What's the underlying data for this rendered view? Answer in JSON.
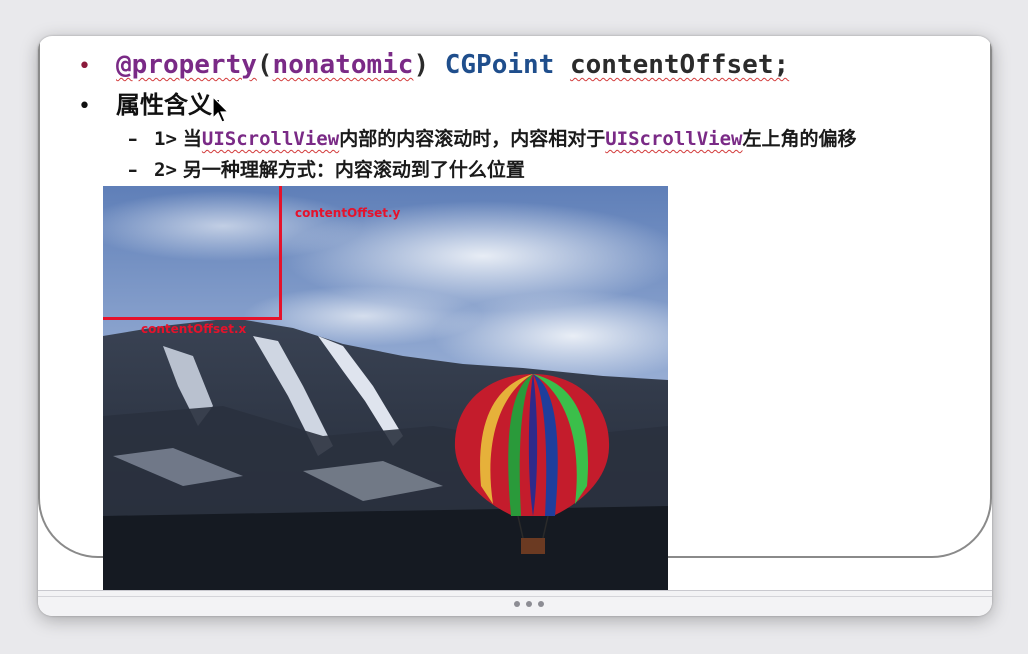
{
  "slide": {
    "line1": {
      "at_property": "@property",
      "open_paren": "(",
      "nonatomic": "nonatomic",
      "close_paren": ")",
      "type": "CGPoint",
      "name": "contentOffset;"
    },
    "heading": "属性含义:",
    "sub_items": [
      {
        "dash": "–",
        "num": "1>",
        "part1": "当",
        "code1": "UIScrollView",
        "part2": "内部的内容滚动时，内容相对于",
        "code2": "UIScrollView",
        "part3": "左上角的偏移"
      },
      {
        "dash": "–",
        "num": "2>",
        "text": "另一种理解方式：内容滚动到了什么位置"
      }
    ]
  },
  "image": {
    "label_y": "contentOffset.y",
    "label_x": "contentOffset.x"
  },
  "colors": {
    "accent_red": "#e5122b",
    "code_purple": "#7a2a86",
    "code_blue": "#1f4e8c"
  }
}
